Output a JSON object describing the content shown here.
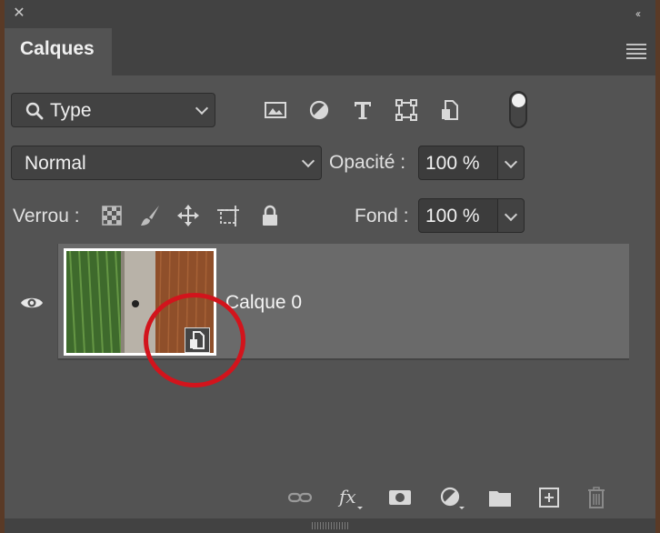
{
  "panel": {
    "tab_label": "Calques",
    "filter": {
      "selected": "Type"
    },
    "blend_mode": {
      "selected": "Normal"
    },
    "opacity": {
      "label": "Opacité :",
      "value": "100 %"
    },
    "lock": {
      "label": "Verrou :"
    },
    "fill": {
      "label": "Fond :",
      "value": "100 %"
    }
  },
  "layers": [
    {
      "name": "Calque 0",
      "visible": true,
      "smart_object": true
    }
  ],
  "filter_icons": [
    "image-filter-icon",
    "adjustment-filter-icon",
    "type-filter-icon",
    "shape-filter-icon",
    "smart-object-filter-icon"
  ],
  "lock_icons": [
    "lock-transparent-pixels-icon",
    "lock-image-pixels-icon",
    "lock-position-icon",
    "lock-artboard-icon",
    "lock-all-icon"
  ],
  "bottom_icons": [
    "link-layers-icon",
    "fx-icon",
    "layer-mask-icon",
    "adjustment-layer-icon",
    "group-folder-icon",
    "new-layer-icon",
    "trash-icon"
  ],
  "colors": {
    "panel": "#535353",
    "header": "#424242",
    "selected_row": "#6a6a6a",
    "annotation_circle": "#d2141c"
  }
}
